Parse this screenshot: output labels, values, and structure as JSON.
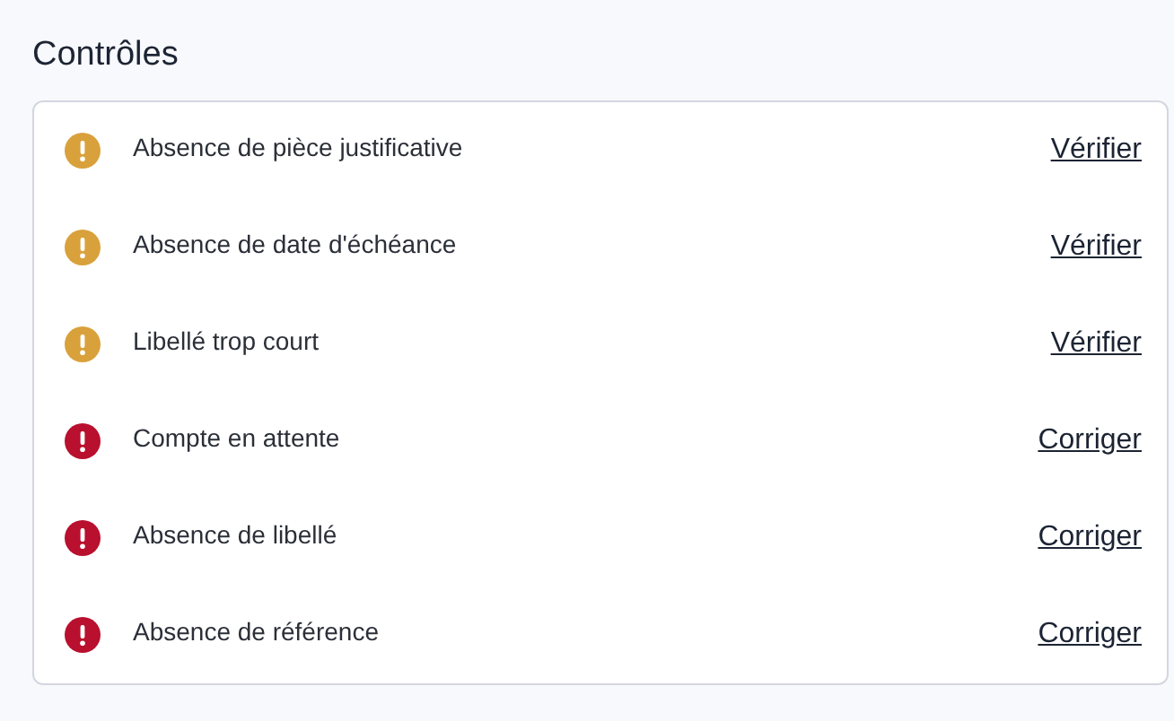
{
  "title": "Contrôles",
  "checks": [
    {
      "label": "Absence de pièce justificative",
      "kind": "warning",
      "action": "Vérifier"
    },
    {
      "label": "Absence de date d'échéance",
      "kind": "warning",
      "action": "Vérifier"
    },
    {
      "label": "Libellé trop court",
      "kind": "warning",
      "action": "Vérifier"
    },
    {
      "label": "Compte en attente",
      "kind": "error",
      "action": "Corriger"
    },
    {
      "label": "Absence de libellé",
      "kind": "error",
      "action": "Corriger"
    },
    {
      "label": "Absence de référence",
      "kind": "error",
      "action": "Corriger"
    }
  ]
}
